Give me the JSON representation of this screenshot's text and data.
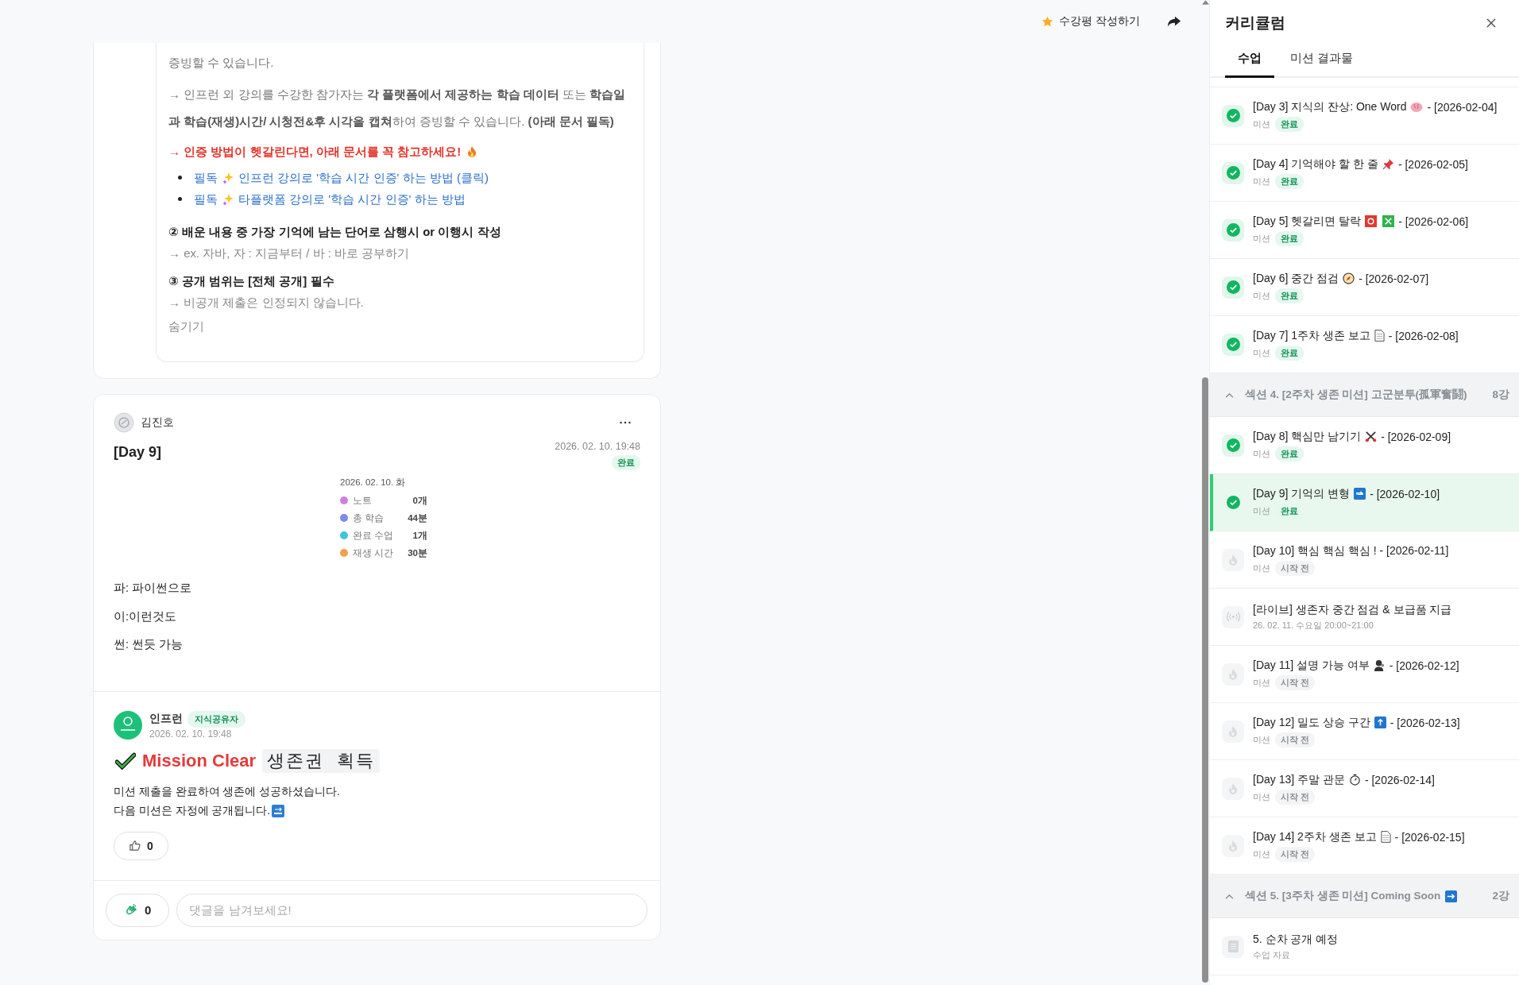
{
  "header": {
    "review_button": "수강평 작성하기"
  },
  "notice": {
    "blocks": [
      {
        "kind": "text",
        "text": "증빙할 수 있습니다."
      },
      {
        "kind": "text",
        "text": "→ 인프런 외 강의를 수강한 참가자는 **각 플랫폼에서 제공하는 학습 데이터** 또는 **학습일과 학습(재생)시간/ 시청전&후 시각을 캡쳐**하여 증빙할 수 있습니다. **(아래 문서 필독)**"
      },
      {
        "kind": "alert",
        "text": "→ 인증 방법이 헷갈린다면, 아래 문서를 꼭 참고하세요!"
      },
      {
        "kind": "links",
        "links": [
          {
            "prefix": "필독",
            "text": "인프런 강의로 '학습 시간 인증' 하는 방법 (클릭)"
          },
          {
            "prefix": "필독",
            "text": "타플랫폼 강의로 '학습 시간 인증' 하는 방법"
          }
        ]
      },
      {
        "kind": "heading",
        "text": "② 배운 내용 중 가장 기억에 남는 단어로 삼행시 or 이행시 작성"
      },
      {
        "kind": "hint",
        "text": "→ ex. 자바, 자 : 지금부터 / 바  : 바로 공부하기"
      },
      {
        "kind": "heading",
        "text": "③ 공개 범위는 [전체 공개] 필수"
      },
      {
        "kind": "hint",
        "text": "→ 비공개 제출은 인정되지 않습니다."
      }
    ],
    "hide_link": "숨기기"
  },
  "post": {
    "author": "김진호",
    "title": "[Day 9]",
    "date": "2026. 02. 10. 19:48",
    "status": "완료",
    "stats": {
      "date": "2026. 02. 10. 화",
      "rows": [
        {
          "label": "노트",
          "value": "0개",
          "color": "#cf7fe0"
        },
        {
          "label": "총 학습",
          "value": "44분",
          "color": "#7b8be8"
        },
        {
          "label": "완료 수업",
          "value": "1개",
          "color": "#3ec6d6"
        },
        {
          "label": "재생 시간",
          "value": "30분",
          "color": "#f5a04a"
        }
      ]
    },
    "body": [
      "파: 파이썬으로",
      "이:이런것도",
      "썬: 썬듯 가능"
    ]
  },
  "comment": {
    "author": "인프런",
    "badge": "지식공유자",
    "date": "2026. 02. 10. 19:48",
    "headline": "Mission Clear",
    "highlight": "생존권  획득",
    "lines": [
      "미션 제출을 완료하여 생존에 성공하셨습니다.",
      "다음 미션은 자정에 공개됩니다."
    ],
    "likes": "0"
  },
  "footer": {
    "claps": "0",
    "comment_placeholder": "댓글을 남겨보세요!"
  },
  "panel": {
    "title": "커리큘럼",
    "tabs": [
      {
        "label": "수업",
        "selected": true
      },
      {
        "label": "미션 결과물",
        "selected": false
      }
    ],
    "rows": [
      {
        "kind": "lesson",
        "title": "[Day 3] 지식의 잔상: One Word",
        "date": "- [2026-02-04]",
        "type": "미션",
        "status": "완료",
        "done": true,
        "selected": false
      },
      {
        "kind": "lesson",
        "title": "[Day 4] 기억해야 할 한 줄",
        "date": "- [2026-02-05]",
        "type": "미션",
        "status": "완료",
        "done": true,
        "selected": false
      },
      {
        "kind": "lesson",
        "title": "[Day 5] 헷갈리면 탈락",
        "date": "- [2026-02-06]",
        "type": "미션",
        "status": "완료",
        "done": true,
        "selected": false
      },
      {
        "kind": "lesson",
        "title": "[Day 6] 중간 점검",
        "date": "- [2026-02-07]",
        "type": "미션",
        "status": "완료",
        "done": true,
        "selected": false
      },
      {
        "kind": "lesson",
        "title": "[Day 7] 1주차 생존 보고",
        "date": "- [2026-02-08]",
        "type": "미션",
        "status": "완료",
        "done": true,
        "selected": false
      },
      {
        "kind": "section",
        "title": "섹션 4. [2주차 생존 미션] 고군분투(孤軍奮鬪)",
        "count": "8강",
        "expanded": true
      },
      {
        "kind": "lesson",
        "title": "[Day 8] 핵심만 남기기",
        "date": "- [2026-02-09]",
        "type": "미션",
        "status": "완료",
        "done": true,
        "selected": false
      },
      {
        "kind": "lesson",
        "title": "[Day 9] 기억의 변형",
        "date": "- [2026-02-10]",
        "type": "미션",
        "status": "완료",
        "done": true,
        "selected": true
      },
      {
        "kind": "lesson",
        "title": "[Day 10] 핵심 핵심 핵심 ! - [2026-02-11]",
        "type": "미션",
        "status": "시작 전",
        "done": false,
        "selected": false
      },
      {
        "kind": "live",
        "title": "[라이브] 생존자 중간 점검 & 보급품 지급",
        "schedule": "26. 02. 11. 수요일 20:00~21:00",
        "selected": false
      },
      {
        "kind": "lesson",
        "title": "[Day 11] 설명 가능 여부",
        "date": "- [2026-02-12]",
        "type": "미션",
        "status": "시작 전",
        "done": false,
        "selected": false
      },
      {
        "kind": "lesson",
        "title": "[Day 12] 밀도 상승 구간",
        "date": "- [2026-02-13]",
        "type": "미션",
        "status": "시작 전",
        "done": false,
        "selected": false
      },
      {
        "kind": "lesson",
        "title": "[Day 13] 주말 관문",
        "date": "- [2026-02-14]",
        "type": "미션",
        "status": "시작 전",
        "done": false,
        "selected": false
      },
      {
        "kind": "lesson",
        "title": "[Day 14] 2주차 생존 보고",
        "date": "- [2026-02-15]",
        "type": "미션",
        "status": "시작 전",
        "done": false,
        "selected": false
      },
      {
        "kind": "section",
        "title": "섹션 5. [3주차 생존 미션] Coming Soon",
        "count": "2강",
        "expanded": true
      },
      {
        "kind": "material",
        "title": "5. 순차 공개 예정",
        "type": "수업 자료",
        "selected": false
      }
    ]
  }
}
